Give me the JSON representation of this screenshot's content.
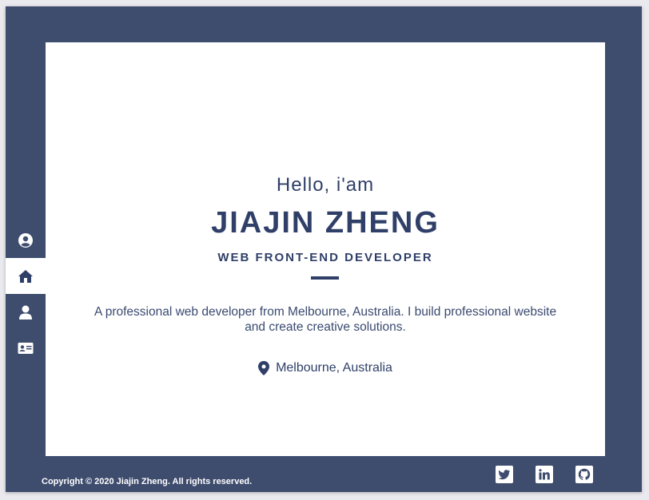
{
  "sidebar": {
    "items": [
      {
        "icon": "user-circle-icon",
        "name": "sidebar-item-account"
      },
      {
        "icon": "home-icon",
        "name": "sidebar-item-home",
        "active": true
      },
      {
        "icon": "user-icon",
        "name": "sidebar-item-about"
      },
      {
        "icon": "id-card-icon",
        "name": "sidebar-item-contact"
      }
    ]
  },
  "hero": {
    "greeting": "Hello, i'am",
    "name": "JIAJIN ZHENG",
    "role": "WEB FRONT-END DEVELOPER",
    "description": "A professional web developer from Melbourne, Australia. I build professional website and create creative solutions.",
    "location": "Melbourne, Australia"
  },
  "footer": {
    "copyright": "Copyright © 2020 Jiajin Zheng. All rights reserved.",
    "social": [
      {
        "icon": "twitter-icon"
      },
      {
        "icon": "linkedin-icon"
      },
      {
        "icon": "github-icon"
      }
    ]
  },
  "colors": {
    "frame": "#3e4c6e",
    "accent": "#2f3f68",
    "background": "#ffffff"
  }
}
